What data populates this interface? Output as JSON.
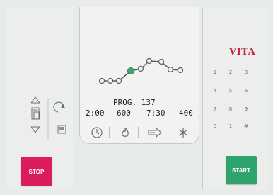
{
  "device": {
    "brand": "VITA",
    "brand_color": "#c21f3a"
  },
  "display": {
    "program_label": "PROG. 137",
    "params": [
      "2:00",
      "600",
      "7:30",
      "400"
    ],
    "icons": [
      "clock-icon",
      "flame-icon",
      "arrow-right-icon",
      "snowflake-icon"
    ],
    "curve_highlight_color": "#3aa86e"
  },
  "keypad": {
    "keys": [
      "1",
      "2",
      "3",
      "4",
      "5",
      "6",
      "7",
      "8",
      "9",
      "0",
      "1",
      "#"
    ]
  },
  "buttons": {
    "stop_label": "STOP",
    "start_label": "START",
    "stop_color": "#dc1d5b",
    "start_color": "#2ea46c"
  },
  "side_controls": {
    "icons": [
      "up-arrow-icon",
      "program-list-icon",
      "down-arrow-icon",
      "refresh-icon",
      "save-icon"
    ]
  }
}
